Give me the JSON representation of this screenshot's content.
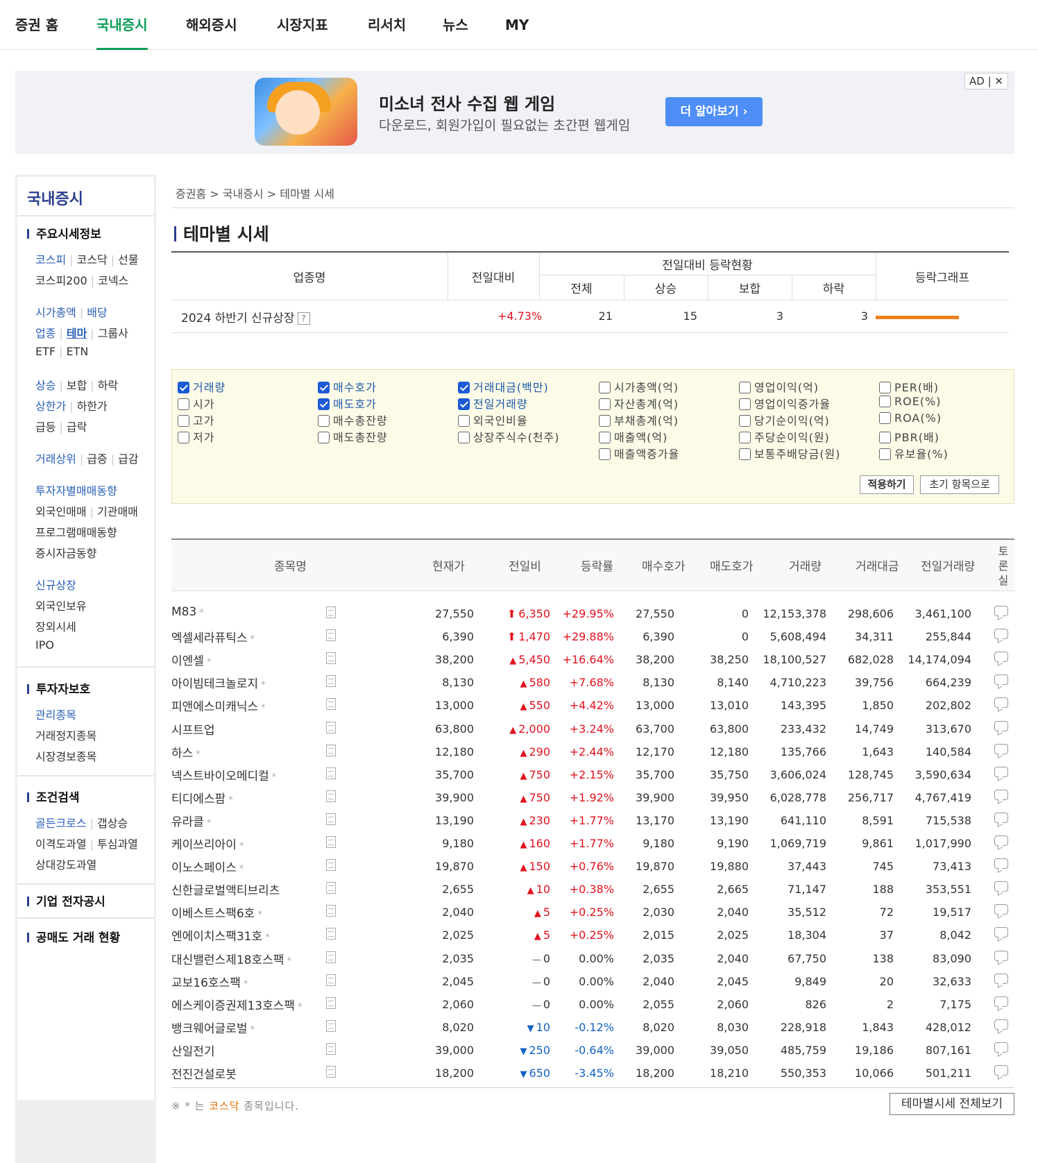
{
  "topnav": {
    "tabs": [
      {
        "label": "증권 홈",
        "active": false
      },
      {
        "label": "국내증시",
        "active": true
      },
      {
        "label": "해외증시",
        "active": false
      },
      {
        "label": "시장지표",
        "active": false
      },
      {
        "label": "리서치",
        "active": false
      },
      {
        "label": "뉴스",
        "active": false
      },
      {
        "label": "MY",
        "active": false
      }
    ]
  },
  "ad": {
    "title": "미소녀 전사 수집 웹 게임",
    "subtitle": "다운로드, 회원가입이 필요없는 초간편 웹게임",
    "button": "더 알아보기 ›",
    "badge": "AD | ✕"
  },
  "sidebar": {
    "title": "국내증시",
    "sections": {
      "main": "주요시세정보",
      "investor": "투자자보호",
      "condition": "조건검색",
      "disclosure": "기업 전자공시",
      "short": "공매도 거래 현황"
    },
    "links": {
      "kospi": "코스피",
      "kosdaq": "코스닥",
      "futures": "선물",
      "kospi200": "코스피200",
      "konex": "코넥스",
      "marketcap": "시가총액",
      "dividend": "배당",
      "sector": "업종",
      "theme": "테마",
      "group": "그룹사",
      "etf": "ETF",
      "etn": "ETN",
      "rise": "상승",
      "flat": "보합",
      "fall": "하락",
      "upper": "상한가",
      "lower": "하한가",
      "surge": "급등",
      "plunge": "급락",
      "topvol": "거래상위",
      "volup": "급증",
      "voldown": "급감",
      "investor_trade": "투자자별매매동향",
      "foreign": "외국인매매",
      "inst": "기관매매",
      "program": "프로그램매매동향",
      "fund": "증시자금동향",
      "newlist": "신규상장",
      "foreign_hold": "외국인보유",
      "otc": "장외시세",
      "ipo": "IPO",
      "managed": "관리종목",
      "suspended": "거래정지종목",
      "warning": "시장경보종목",
      "golden": "골든크로스",
      "gapup": "갭상승",
      "disparity": "이격도과열",
      "psych": "투심과열",
      "rsi": "상대강도과열"
    }
  },
  "breadcrumb": {
    "home": "증권홈",
    "domestic": "국내증시",
    "current": "테마별 시세",
    "sep": ">"
  },
  "page_title": "테마별 시세",
  "summary": {
    "headers": {
      "name": "업종명",
      "change": "전일대비",
      "group": "전일대비 등락현황",
      "total": "전체",
      "up": "상승",
      "flat": "보합",
      "down": "하락",
      "graph": "등락그래프"
    },
    "row": {
      "name": "2024 하반기 신규상장",
      "help": "?",
      "change": "+4.73%",
      "total": "21",
      "up": "15",
      "flat": "3",
      "down": "3",
      "bar_fraction": 1.0
    }
  },
  "filters": {
    "items": [
      {
        "label": "거래량",
        "checked": true
      },
      {
        "label": "시가",
        "checked": false
      },
      {
        "label": "고가",
        "checked": false
      },
      {
        "label": "저가",
        "checked": false
      },
      {
        "label": "매수호가",
        "checked": true
      },
      {
        "label": "매도호가",
        "checked": true
      },
      {
        "label": "매수총잔량",
        "checked": false
      },
      {
        "label": "매도총잔량",
        "checked": false
      },
      {
        "label": "거래대금(백만)",
        "checked": true
      },
      {
        "label": "전일거래량",
        "checked": true
      },
      {
        "label": "외국인비율",
        "checked": false
      },
      {
        "label": "상장주식수(천주)",
        "checked": false
      },
      {
        "label": "시가총액(억)",
        "checked": false
      },
      {
        "label": "자산총계(억)",
        "checked": false
      },
      {
        "label": "부채총계(억)",
        "checked": false
      },
      {
        "label": "매출액(억)",
        "checked": false
      },
      {
        "label": "매출액증가율",
        "checked": false
      },
      {
        "label": "영업이익(억)",
        "checked": false
      },
      {
        "label": "영업이익증가율",
        "checked": false
      },
      {
        "label": "당기순이익(억)",
        "checked": false
      },
      {
        "label": "주당순이익(원)",
        "checked": false
      },
      {
        "label": "보통주배당금(원)",
        "checked": false
      },
      {
        "label": "PER(배)",
        "checked": false
      },
      {
        "label": "ROE(%)",
        "checked": false
      },
      {
        "label": "ROA(%)",
        "checked": false
      },
      {
        "label": "PBR(배)",
        "checked": false
      },
      {
        "label": "유보율(%)",
        "checked": false
      }
    ],
    "apply": "적용하기",
    "reset": "초기 항목으로"
  },
  "stocks": {
    "headers": [
      "종목명",
      "현재가",
      "전일비",
      "등락률",
      "매수호가",
      "매도호가",
      "거래량",
      "거래대금",
      "전일거래량",
      "토론실"
    ],
    "rows": [
      {
        "name": "M83",
        "kosdaq": true,
        "price": "27,550",
        "dir": "upper",
        "diff": "6,350",
        "rate": "+29.95%",
        "bid": "27,550",
        "ask": "0",
        "vol": "12,153,378",
        "amt": "298,606",
        "prev": "3,461,100"
      },
      {
        "name": "엑셀세라퓨틱스",
        "kosdaq": true,
        "price": "6,390",
        "dir": "upper",
        "diff": "1,470",
        "rate": "+29.88%",
        "bid": "6,390",
        "ask": "0",
        "vol": "5,608,494",
        "amt": "34,311",
        "prev": "255,844"
      },
      {
        "name": "이엔셀",
        "kosdaq": true,
        "price": "38,200",
        "dir": "up",
        "diff": "5,450",
        "rate": "+16.64%",
        "bid": "38,200",
        "ask": "38,250",
        "vol": "18,100,527",
        "amt": "682,028",
        "prev": "14,174,094"
      },
      {
        "name": "아이빔테크놀로지",
        "kosdaq": true,
        "price": "8,130",
        "dir": "up",
        "diff": "580",
        "rate": "+7.68%",
        "bid": "8,130",
        "ask": "8,140",
        "vol": "4,710,223",
        "amt": "39,756",
        "prev": "664,239"
      },
      {
        "name": "피앤에스미캐닉스",
        "kosdaq": true,
        "price": "13,000",
        "dir": "up",
        "diff": "550",
        "rate": "+4.42%",
        "bid": "13,000",
        "ask": "13,010",
        "vol": "143,395",
        "amt": "1,850",
        "prev": "202,802"
      },
      {
        "name": "시프트업",
        "kosdaq": false,
        "price": "63,800",
        "dir": "up",
        "diff": "2,000",
        "rate": "+3.24%",
        "bid": "63,700",
        "ask": "63,800",
        "vol": "233,432",
        "amt": "14,749",
        "prev": "313,670"
      },
      {
        "name": "하스",
        "kosdaq": true,
        "price": "12,180",
        "dir": "up",
        "diff": "290",
        "rate": "+2.44%",
        "bid": "12,170",
        "ask": "12,180",
        "vol": "135,766",
        "amt": "1,643",
        "prev": "140,584"
      },
      {
        "name": "넥스트바이오메디컬",
        "kosdaq": true,
        "price": "35,700",
        "dir": "up",
        "diff": "750",
        "rate": "+2.15%",
        "bid": "35,700",
        "ask": "35,750",
        "vol": "3,606,024",
        "amt": "128,745",
        "prev": "3,590,634"
      },
      {
        "name": "티디에스팜",
        "kosdaq": true,
        "price": "39,900",
        "dir": "up",
        "diff": "750",
        "rate": "+1.92%",
        "bid": "39,900",
        "ask": "39,950",
        "vol": "6,028,778",
        "amt": "256,717",
        "prev": "4,767,419"
      },
      {
        "name": "유라클",
        "kosdaq": true,
        "price": "13,190",
        "dir": "up",
        "diff": "230",
        "rate": "+1.77%",
        "bid": "13,170",
        "ask": "13,190",
        "vol": "641,110",
        "amt": "8,591",
        "prev": "715,538"
      },
      {
        "name": "케이쓰리아이",
        "kosdaq": true,
        "price": "9,180",
        "dir": "up",
        "diff": "160",
        "rate": "+1.77%",
        "bid": "9,180",
        "ask": "9,190",
        "vol": "1,069,719",
        "amt": "9,861",
        "prev": "1,017,990"
      },
      {
        "name": "이노스페이스",
        "kosdaq": true,
        "price": "19,870",
        "dir": "up",
        "diff": "150",
        "rate": "+0.76%",
        "bid": "19,870",
        "ask": "19,880",
        "vol": "37,443",
        "amt": "745",
        "prev": "73,413"
      },
      {
        "name": "신한글로벌액티브리츠",
        "kosdaq": false,
        "price": "2,655",
        "dir": "up",
        "diff": "10",
        "rate": "+0.38%",
        "bid": "2,655",
        "ask": "2,665",
        "vol": "71,147",
        "amt": "188",
        "prev": "353,551"
      },
      {
        "name": "이베스트스팩6호",
        "kosdaq": true,
        "price": "2,040",
        "dir": "up",
        "diff": "5",
        "rate": "+0.25%",
        "bid": "2,030",
        "ask": "2,040",
        "vol": "35,512",
        "amt": "72",
        "prev": "19,517"
      },
      {
        "name": "엔에이치스팩31호",
        "kosdaq": true,
        "price": "2,025",
        "dir": "up",
        "diff": "5",
        "rate": "+0.25%",
        "bid": "2,015",
        "ask": "2,025",
        "vol": "18,304",
        "amt": "37",
        "prev": "8,042"
      },
      {
        "name": "대신밸런스제18호스팩",
        "kosdaq": true,
        "price": "2,035",
        "dir": "flat",
        "diff": "0",
        "rate": "0.00%",
        "bid": "2,035",
        "ask": "2,040",
        "vol": "67,750",
        "amt": "138",
        "prev": "83,090"
      },
      {
        "name": "교보16호스팩",
        "kosdaq": true,
        "price": "2,045",
        "dir": "flat",
        "diff": "0",
        "rate": "0.00%",
        "bid": "2,040",
        "ask": "2,045",
        "vol": "9,849",
        "amt": "20",
        "prev": "32,633"
      },
      {
        "name": "에스케이증권제13호스팩",
        "kosdaq": true,
        "price": "2,060",
        "dir": "flat",
        "diff": "0",
        "rate": "0.00%",
        "bid": "2,055",
        "ask": "2,060",
        "vol": "826",
        "amt": "2",
        "prev": "7,175"
      },
      {
        "name": "뱅크웨어글로벌",
        "kosdaq": true,
        "price": "8,020",
        "dir": "down",
        "diff": "10",
        "rate": "-0.12%",
        "bid": "8,020",
        "ask": "8,030",
        "vol": "228,918",
        "amt": "1,843",
        "prev": "428,012"
      },
      {
        "name": "산일전기",
        "kosdaq": false,
        "price": "39,000",
        "dir": "down",
        "diff": "250",
        "rate": "-0.64%",
        "bid": "39,000",
        "ask": "39,050",
        "vol": "485,759",
        "amt": "19,186",
        "prev": "807,161"
      },
      {
        "name": "전진건설로봇",
        "kosdaq": false,
        "price": "18,200",
        "dir": "down",
        "diff": "650",
        "rate": "-3.45%",
        "bid": "18,200",
        "ask": "18,210",
        "vol": "550,353",
        "amt": "10,066",
        "prev": "501,211"
      }
    ]
  },
  "footer": {
    "note_prefix": "※ * 는 ",
    "note_highlight": "코스닥",
    "note_suffix": " 종목입니다.",
    "all_button": "테마별시세 전체보기"
  },
  "colors": {
    "accent": "#0a9e57",
    "up": "#e1121e",
    "down": "#1261c4",
    "bar": "#f07e1a",
    "navy": "#2a3d8f"
  }
}
